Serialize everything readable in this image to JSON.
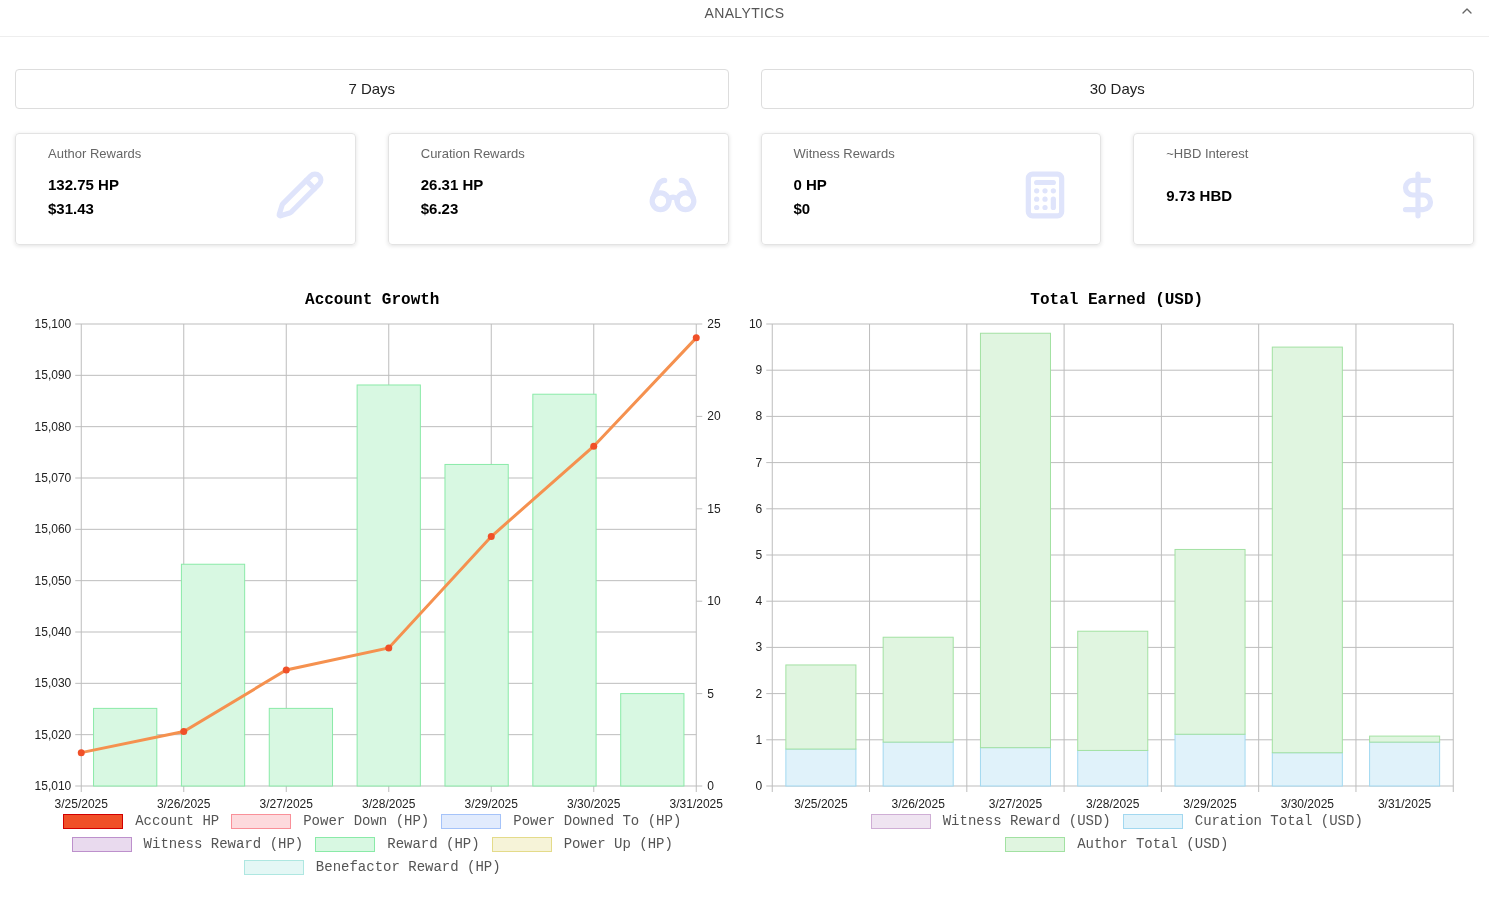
{
  "header": {
    "title": "ANALYTICS"
  },
  "periods": [
    {
      "label": "7 Days"
    },
    {
      "label": "30 Days"
    }
  ],
  "cards": [
    {
      "kind": "author",
      "title": "Author Rewards",
      "values": [
        "132.75 HP",
        "$31.43"
      ]
    },
    {
      "kind": "curation",
      "title": "Curation Rewards",
      "values": [
        "26.31 HP",
        "$6.23"
      ]
    },
    {
      "kind": "witness",
      "title": "Witness Rewards",
      "values": [
        "0 HP",
        "$0"
      ]
    },
    {
      "kind": "interest",
      "title": "~HBD Interest",
      "values": [
        "9.73 HBD"
      ]
    }
  ],
  "charts": [
    {
      "chart_data": {
        "type": "bar",
        "title": "Account Growth",
        "grid": true,
        "categories": [
          "3/25/2025",
          "3/26/2025",
          "3/27/2025",
          "3/28/2025",
          "3/29/2025",
          "3/30/2025",
          "3/31/2025"
        ],
        "ylim": [
          15010,
          15100
        ],
        "yticks": [
          {
            "value": 15010,
            "label": "15,010"
          },
          {
            "value": 15020,
            "label": "15,020"
          },
          {
            "value": 15030,
            "label": "15,030"
          },
          {
            "value": 15040,
            "label": "15,040"
          },
          {
            "value": 15050,
            "label": "15,050"
          },
          {
            "value": 15060,
            "label": "15,060"
          },
          {
            "value": 15070,
            "label": "15,070"
          },
          {
            "value": 15080,
            "label": "15,080"
          },
          {
            "value": 15090,
            "label": "15,090"
          },
          {
            "value": 15100,
            "label": "15,100"
          }
        ],
        "y2lim": [
          0,
          25
        ],
        "y2ticks": [
          0,
          5,
          10,
          15,
          20,
          25
        ],
        "series": [
          {
            "name": "Account HP",
            "type": "line",
            "marker": true,
            "color": "#f05028",
            "values": [
              15016.5,
              15020.6,
              15032.6,
              15036.9,
              15058.6,
              15076.2,
              15097.3
            ]
          },
          {
            "name": "Power Down (HP)",
            "type": "bar",
            "axis": "y2",
            "color": "#fddadd",
            "values": [
              0,
              0,
              0,
              0,
              0,
              0,
              0
            ]
          },
          {
            "name": "Power Downed To (HP)",
            "type": "bar",
            "axis": "y2",
            "color": "#e1ebfd",
            "values": [
              0,
              0,
              0,
              0,
              0,
              0,
              0
            ]
          },
          {
            "name": "Witness Reward (HP)",
            "type": "bar",
            "axis": "y2",
            "color": "#e9daee",
            "values": [
              0,
              0,
              0,
              0,
              0,
              0,
              0
            ]
          },
          {
            "name": "Reward (HP)",
            "type": "bar",
            "axis": "y2",
            "color": "#d8f8e2",
            "values": [
              4.2,
              12.0,
              4.2,
              21.7,
              17.4,
              21.2,
              5.0
            ]
          },
          {
            "name": "Power Up (HP)",
            "type": "bar",
            "axis": "y2",
            "color": "#f6f3d8",
            "values": [
              0,
              0,
              0,
              0,
              0,
              0,
              0
            ]
          },
          {
            "name": "Benefactor Reward (HP)",
            "type": "bar",
            "axis": "y2",
            "color": "#e4f7f5",
            "values": [
              0,
              0,
              0,
              0,
              0,
              0,
              0
            ]
          }
        ]
      }
    },
    {
      "chart_data": {
        "type": "bar",
        "title": "Total Earned (USD)",
        "grid": true,
        "stacked": true,
        "categories": [
          "3/25/2025",
          "3/26/2025",
          "3/27/2025",
          "3/28/2025",
          "3/29/2025",
          "3/30/2025",
          "3/31/2025"
        ],
        "ylim": [
          0,
          10
        ],
        "yticks": [
          0,
          1,
          2,
          3,
          4,
          5,
          6,
          7,
          8,
          9,
          10
        ],
        "series": [
          {
            "name": "Witness Reward (USD)",
            "type": "bar",
            "color": "#efe4f1",
            "values": [
              0,
              0,
              0,
              0,
              0,
              0,
              0
            ]
          },
          {
            "name": "Curation Total (USD)",
            "type": "bar",
            "color": "#e0f2fa",
            "values": [
              0.8,
              0.95,
              0.83,
              0.77,
              1.12,
              0.72,
              0.95
            ]
          },
          {
            "name": "Author Total (USD)",
            "type": "bar",
            "color": "#e0f5e0",
            "values": [
              1.82,
              2.27,
              8.97,
              2.58,
              4.0,
              8.78,
              0.13
            ]
          }
        ]
      }
    }
  ]
}
